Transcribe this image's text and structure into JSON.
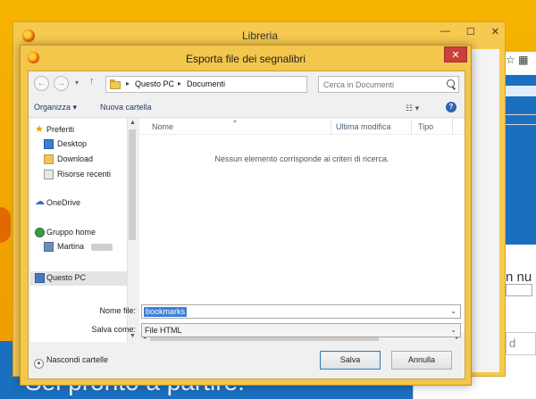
{
  "background": {
    "welcome_text": "Sei pronto a partire!",
    "right_text": "n nu",
    "right_input_text": "d"
  },
  "library_window": {
    "title": "Libreria",
    "minimize_icon": "minimize-icon",
    "maximize_icon": "maximize-icon",
    "close_icon": "close-icon"
  },
  "dialog": {
    "title": "Esporta file dei segnalibri",
    "close_glyph": "✕",
    "address": {
      "segments": [
        "Questo PC",
        "Documenti"
      ]
    },
    "search": {
      "placeholder": "Cerca in Documenti"
    },
    "toolbar": {
      "organize_label": "Organizza ▾",
      "new_folder_label": "Nuova cartella",
      "view_glyph": "☷ ▾",
      "help_glyph": "?"
    },
    "nav_pane": {
      "favorites": "Preferiti",
      "desktop": "Desktop",
      "download": "Download",
      "recent": "Risorse recenti",
      "onedrive": "OneDrive",
      "homegroup": "Gruppo home",
      "user": "Martina",
      "this_pc": "Questo PC"
    },
    "file_list": {
      "columns": {
        "name": "Nome",
        "modified": "Ultima modifica",
        "type": "Tipo"
      },
      "empty_message": "Nessun elemento corrisponde ai criteri di ricerca."
    },
    "filename": {
      "label": "Nome file:",
      "value": "bookmarks"
    },
    "save_as": {
      "label": "Salva come:",
      "value": "File HTML"
    },
    "hide_folders_label": "Nascondi cartelle",
    "save_button": "Salva",
    "cancel_button": "Annulla"
  }
}
